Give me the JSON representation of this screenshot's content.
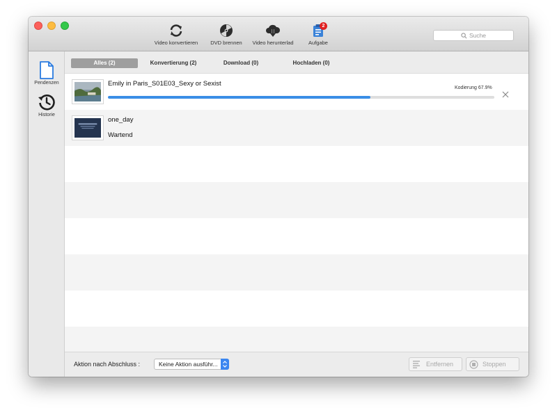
{
  "toolbar": {
    "convert_label": "Video konvertieren",
    "dvd_label": "DVD brennen",
    "download_label": "Video herunterlad",
    "task_label": "Aufgabe",
    "task_badge": "2",
    "search_placeholder": "Suche"
  },
  "sidebar": {
    "items": [
      {
        "label": "Pendenzen",
        "icon": "document-icon"
      },
      {
        "label": "Historie",
        "icon": "history-icon"
      }
    ]
  },
  "tabs": [
    {
      "label": "Alles (2)",
      "active": true
    },
    {
      "label": "Konvertierung (2)",
      "active": false
    },
    {
      "label": "Download (0)",
      "active": false
    },
    {
      "label": "Hochladen (0)",
      "active": false
    }
  ],
  "tasks": [
    {
      "title": "Emily in Paris_S01E03_Sexy or Sexist",
      "progress_label": "Kodierung 67.9%",
      "progress": 0.679
    },
    {
      "title": "one_day",
      "status": "Wartend"
    }
  ],
  "bottom": {
    "after_label": "Aktion nach Abschluss :",
    "select_value": "Keine Aktion ausführ...",
    "remove_label": "Entfernen",
    "stop_label": "Stoppen"
  },
  "colors": {
    "progress": "#3a8ee6",
    "badge": "#e02020",
    "accent": "#3b86f0"
  }
}
